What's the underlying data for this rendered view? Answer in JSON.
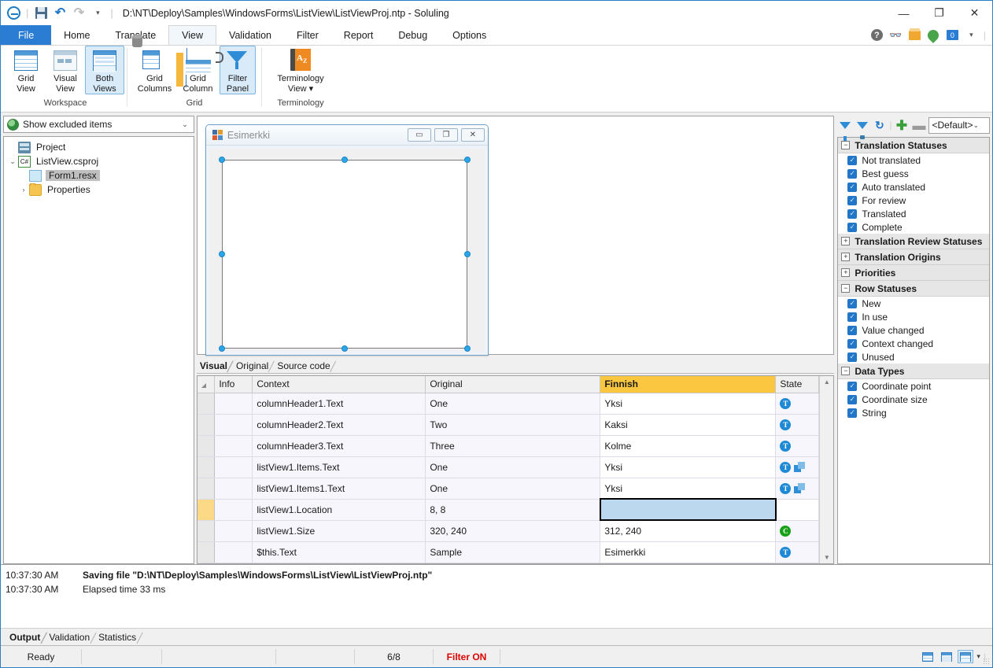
{
  "window": {
    "title": "D:\\NT\\Deploy\\Samples\\WindowsForms\\ListView\\ListViewProj.ntp  -  Soluling",
    "minimize": "—",
    "maximize": "❐",
    "close": "✕",
    "quick_access": {
      "app_icon": "soluling-logo-icon",
      "save": "save-icon",
      "undo": "↶",
      "redo": "↷",
      "more": "▾"
    }
  },
  "ribbon": {
    "tabs": [
      {
        "label": "File",
        "active": false,
        "is_file": true
      },
      {
        "label": "Home",
        "active": false
      },
      {
        "label": "Translate",
        "active": false
      },
      {
        "label": "View",
        "active": true
      },
      {
        "label": "Validation",
        "active": false
      },
      {
        "label": "Filter",
        "active": false
      },
      {
        "label": "Report",
        "active": false
      },
      {
        "label": "Debug",
        "active": false
      },
      {
        "label": "Options",
        "active": false
      }
    ],
    "right_icons": [
      "help-icon",
      "binoculars-icon",
      "box-icon",
      "globe-pin-icon",
      "monitor-icon",
      "chevron-down-icon"
    ],
    "groups": [
      {
        "label": "Workspace",
        "buttons": [
          {
            "label": "Grid\nView",
            "line1": "Grid",
            "line2": "View",
            "icon": "grid-view-icon",
            "selected": false
          },
          {
            "label": "Visual\nView",
            "line1": "Visual",
            "line2": "View",
            "icon": "visual-view-icon",
            "selected": false
          },
          {
            "label": "Both\nViews",
            "line1": "Both",
            "line2": "Views",
            "icon": "both-views-icon",
            "selected": true
          }
        ]
      },
      {
        "label": "Grid",
        "buttons": [
          {
            "line1": "Grid",
            "line2": "Columns",
            "icon": "grid-columns-icon",
            "selected": false
          },
          {
            "line1": "Grid",
            "line2": "Column",
            "icon": "grid-column-icon",
            "selected": false
          },
          {
            "line1": "Filter",
            "line2": "Panel",
            "icon": "filter-panel-icon",
            "selected": true
          }
        ]
      },
      {
        "label": "Terminology",
        "buttons": [
          {
            "line1": "Terminology",
            "line2": "View ▾",
            "icon": "terminology-view-icon",
            "selected": false
          }
        ]
      }
    ]
  },
  "left_pane": {
    "filter_combo": {
      "value": "Show excluded items",
      "icon": "globe-icon",
      "arrow": "⌄"
    },
    "tree": [
      {
        "label": "Project",
        "icon": "project-icon",
        "indent": 0,
        "expander": "",
        "selected": false
      },
      {
        "label": "ListView.csproj",
        "icon": "csharp-icon",
        "icon_text": "C#",
        "indent": 1,
        "expander": "⌄",
        "selected": false
      },
      {
        "label": "Form1.resx",
        "icon": "resx-icon",
        "indent": 2,
        "expander": "",
        "selected": true
      },
      {
        "label": "Properties",
        "icon": "folder-icon",
        "indent": 2,
        "expander": "›",
        "selected": false
      }
    ]
  },
  "designer": {
    "form_title": "Esimerkki",
    "form_icon": "winforms-icon",
    "window_buttons": [
      {
        "name": "minimize",
        "glyph": "▭"
      },
      {
        "name": "maximize",
        "glyph": "❐"
      },
      {
        "name": "close",
        "glyph": "✕"
      }
    ],
    "tabs": [
      {
        "label": "Visual",
        "active": true
      },
      {
        "label": "Original",
        "active": false
      },
      {
        "label": "Source code",
        "active": false
      }
    ]
  },
  "grid": {
    "columns": [
      "",
      "Info",
      "Context",
      "Original",
      "Finnish",
      "State"
    ],
    "highlight_column": "Finnish",
    "rows": [
      {
        "info": "",
        "context": "columnHeader1.Text",
        "original": "One",
        "finnish": "Yksi",
        "state": [
          "T"
        ],
        "marked": false,
        "editing": false
      },
      {
        "info": "",
        "context": "columnHeader2.Text",
        "original": "Two",
        "finnish": "Kaksi",
        "state": [
          "T"
        ],
        "marked": false,
        "editing": false
      },
      {
        "info": "",
        "context": "columnHeader3.Text",
        "original": "Three",
        "finnish": "Kolme",
        "state": [
          "T"
        ],
        "marked": false,
        "editing": false
      },
      {
        "info": "",
        "context": "listView1.Items.Text",
        "original": "One",
        "finnish": "Yksi",
        "state": [
          "T",
          "DUP"
        ],
        "marked": false,
        "editing": false
      },
      {
        "info": "",
        "context": "listView1.Items1.Text",
        "original": "One",
        "finnish": "Yksi",
        "state": [
          "T",
          "DUP"
        ],
        "marked": false,
        "editing": false
      },
      {
        "info": "",
        "context": "listView1.Location",
        "original": "8, 8",
        "finnish": "",
        "state": [],
        "marked": true,
        "editing": true
      },
      {
        "info": "",
        "context": "listView1.Size",
        "original": "320, 240",
        "finnish": "312, 240",
        "state": [
          "C"
        ],
        "marked": false,
        "editing": false
      },
      {
        "info": "",
        "context": "$this.Text",
        "original": "Sample",
        "finnish": "Esimerkki",
        "state": [
          "T"
        ],
        "marked": false,
        "editing": false
      }
    ]
  },
  "filter_panel": {
    "toolbar": {
      "filter_icon": "filter-icon",
      "filter_clear_icon": "filter-clear-icon",
      "refresh_icon": "refresh-icon",
      "add_icon": "add-icon",
      "remove_icon": "remove-icon",
      "preset": "<Default>",
      "preset_arrow": "⌄"
    },
    "groups": [
      {
        "title": "Translation Statuses",
        "expanded": true,
        "sign": "−",
        "items": [
          {
            "label": "Not translated",
            "checked": true
          },
          {
            "label": "Best guess",
            "checked": true
          },
          {
            "label": "Auto translated",
            "checked": true
          },
          {
            "label": "For review",
            "checked": true
          },
          {
            "label": "Translated",
            "checked": true
          },
          {
            "label": "Complete",
            "checked": true
          }
        ]
      },
      {
        "title": "Translation Review Statuses",
        "expanded": false,
        "sign": "+",
        "items": []
      },
      {
        "title": "Translation Origins",
        "expanded": false,
        "sign": "+",
        "items": []
      },
      {
        "title": "Priorities",
        "expanded": false,
        "sign": "+",
        "items": []
      },
      {
        "title": "Row Statuses",
        "expanded": true,
        "sign": "−",
        "items": [
          {
            "label": "New",
            "checked": true
          },
          {
            "label": "In use",
            "checked": true
          },
          {
            "label": "Value changed",
            "checked": true
          },
          {
            "label": "Context changed",
            "checked": true
          },
          {
            "label": "Unused",
            "checked": true
          }
        ]
      },
      {
        "title": "Data Types",
        "expanded": true,
        "sign": "−",
        "items": [
          {
            "label": "Coordinate point",
            "checked": true
          },
          {
            "label": "Coordinate size",
            "checked": true
          },
          {
            "label": "String",
            "checked": true
          }
        ]
      }
    ]
  },
  "output": {
    "lines": [
      {
        "time": "10:37:30 AM",
        "message": "Saving file \"D:\\NT\\Deploy\\Samples\\WindowsForms\\ListView\\ListViewProj.ntp\"",
        "bold": true
      },
      {
        "time": "10:37:30 AM",
        "message": "Elapsed time 33 ms",
        "bold": false
      }
    ],
    "tabs": [
      {
        "label": "Output",
        "active": true
      },
      {
        "label": "Validation",
        "active": false
      },
      {
        "label": "Statistics",
        "active": false
      }
    ]
  },
  "status_bar": {
    "ready": "Ready",
    "count": "6/8",
    "filter": "Filter ON",
    "view_buttons": [
      {
        "name": "grid-view-button",
        "selected": false
      },
      {
        "name": "visual-view-button",
        "selected": false
      },
      {
        "name": "both-views-button",
        "selected": true
      }
    ],
    "view_dropdown": "▾"
  },
  "colors": {
    "accent": "#2b7cd3",
    "highlight_header": "#fbc640",
    "filter_on": "#e00000",
    "selection": "#bcd8ee"
  }
}
